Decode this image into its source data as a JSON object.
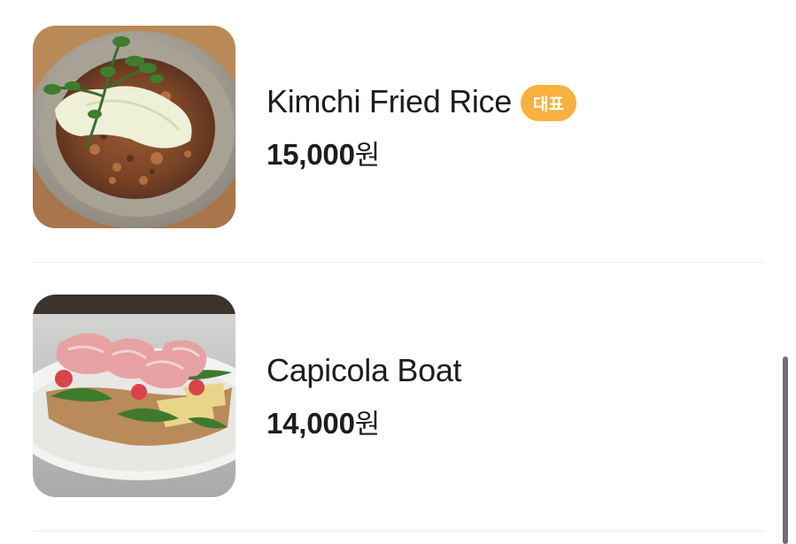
{
  "menu": {
    "items": [
      {
        "name": "Kimchi Fried Rice",
        "badge": "대표",
        "price": "15,000",
        "currency_unit": "원",
        "image_icon": "kimchi-fried-rice-photo"
      },
      {
        "name": "Capicola Boat",
        "badge": "",
        "price": "14,000",
        "currency_unit": "원",
        "image_icon": "capicola-boat-photo"
      }
    ]
  },
  "colors": {
    "badge_background": "#f6b13e",
    "badge_text": "#ffffff",
    "text": "#1d1d1d",
    "divider": "#ececec",
    "scrollbar": "#6f6f6f"
  }
}
